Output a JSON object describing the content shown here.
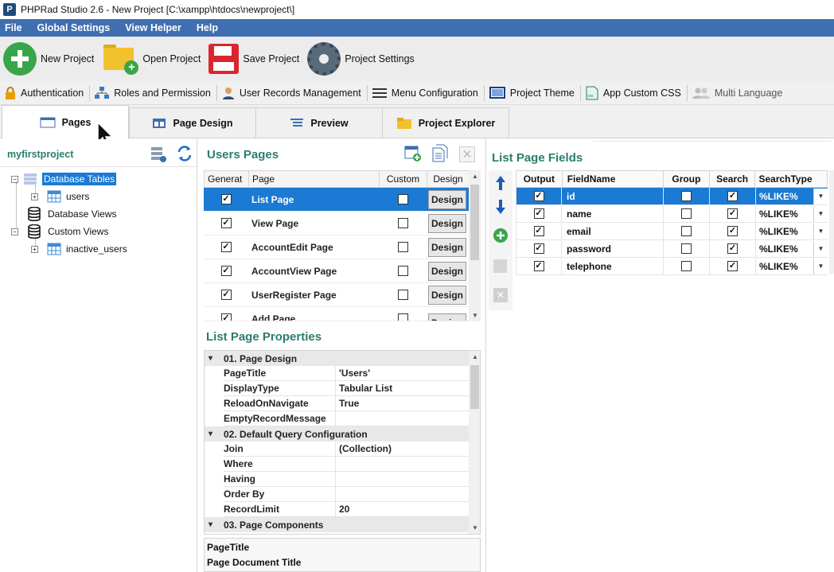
{
  "window": {
    "title": "PHPRad Studio 2.6 - New Project [C:\\xampp\\htdocs\\newproject\\]",
    "logo": "P"
  },
  "menu": [
    "File",
    "Global Settings",
    "View Helper",
    "Help"
  ],
  "toolbar": {
    "new_project": "New Project",
    "open_project": "Open Project",
    "save_project": "Save Project",
    "project_settings": "Project Settings"
  },
  "toolbar2": {
    "authentication": "Authentication",
    "roles": "Roles and Permission",
    "user_records": "User Records Management",
    "menu_config": "Menu Configuration",
    "project_theme": "Project Theme",
    "custom_css": "App Custom CSS",
    "multi_language": "Multi Language"
  },
  "tabs": {
    "pages": "Pages",
    "page_design": "Page Design",
    "preview": "Preview",
    "project_explorer": "Project Explorer"
  },
  "left": {
    "project_name": "myfirstproject",
    "tree": {
      "database_tables": "Database Tables",
      "users": "users",
      "database_views": "Database Views",
      "custom_views": "Custom Views",
      "inactive_users": "inactive_users"
    }
  },
  "pages_panel": {
    "title": "Users Pages",
    "columns": {
      "generate": "Generat",
      "page": "Page",
      "custom": "Custom",
      "design": "Design"
    },
    "rows": [
      {
        "page": "List Page",
        "generate": true,
        "custom": false,
        "design": "Design"
      },
      {
        "page": "View Page",
        "generate": true,
        "custom": false,
        "design": "Design"
      },
      {
        "page": "AccountEdit Page",
        "generate": true,
        "custom": false,
        "design": "Design"
      },
      {
        "page": "AccountView Page",
        "generate": true,
        "custom": false,
        "design": "Design"
      },
      {
        "page": "UserRegister Page",
        "generate": true,
        "custom": false,
        "design": "Design"
      },
      {
        "page": "Add Page",
        "generate": true,
        "custom": false,
        "design": "Design"
      }
    ]
  },
  "properties": {
    "title": "List Page Properties",
    "cat1": "01. Page Design",
    "page_title_k": "PageTitle",
    "page_title_v": "'Users'",
    "display_type_k": "DisplayType",
    "display_type_v": "Tabular List",
    "reload_k": "ReloadOnNavigate",
    "reload_v": "True",
    "empty_k": "EmptyRecordMessage",
    "empty_v": "",
    "cat2": "02. Default Query Configuration",
    "join_k": "Join",
    "join_v": "(Collection)",
    "where_k": "Where",
    "where_v": "",
    "having_k": "Having",
    "having_v": "",
    "orderby_k": "Order By",
    "orderby_v": "",
    "limit_k": "RecordLimit",
    "limit_v": "20",
    "cat3": "03. Page Components",
    "desc_title": "PageTitle",
    "desc_text": "Page Document Title"
  },
  "fields": {
    "title": "List Page Fields",
    "columns": {
      "output": "Output",
      "fieldname": "FieldName",
      "group": "Group",
      "search": "Search",
      "searchtype": "SearchType"
    },
    "rows": [
      {
        "name": "id",
        "output": true,
        "group": false,
        "search": true,
        "searchtype": "%LIKE%"
      },
      {
        "name": "name",
        "output": true,
        "group": false,
        "search": true,
        "searchtype": "%LIKE%"
      },
      {
        "name": "email",
        "output": true,
        "group": false,
        "search": true,
        "searchtype": "%LIKE%"
      },
      {
        "name": "password",
        "output": true,
        "group": false,
        "search": true,
        "searchtype": "%LIKE%"
      },
      {
        "name": "telephone",
        "output": true,
        "group": false,
        "search": true,
        "searchtype": "%LIKE%"
      }
    ]
  },
  "colors": {
    "menubar": "#3f6fb0",
    "selection": "#1a7ad4",
    "section_title": "#2a7d6d"
  }
}
